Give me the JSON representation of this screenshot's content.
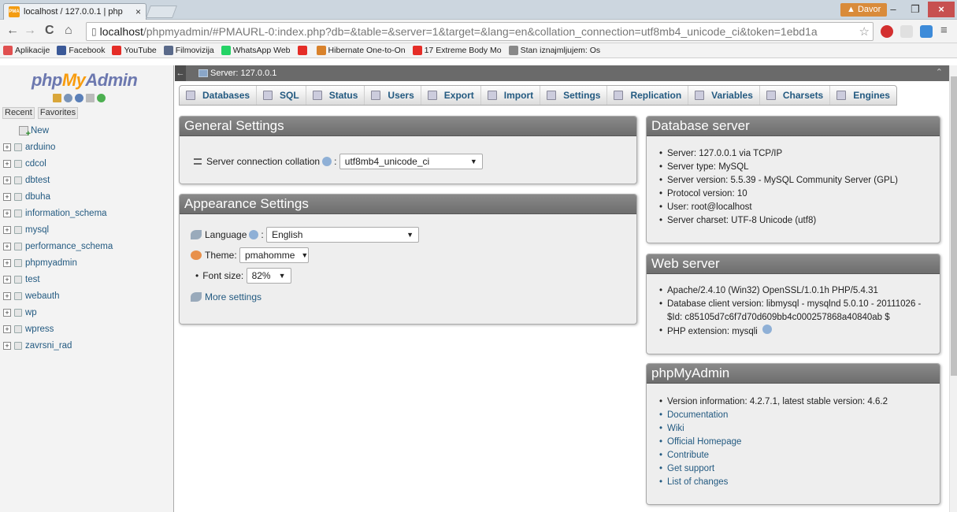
{
  "browser": {
    "tab_title": "localhost / 127.0.0.1 | php",
    "tab_close": "×",
    "user_badge": "Davor",
    "min": "–",
    "max": "❐",
    "close": "×",
    "url_host": "localhost",
    "url_rest": "/phpmyadmin/#PMAURL-0:index.php?db=&table=&server=1&target=&lang=en&collation_connection=utf8mb4_unicode_ci&token=1ebd1a",
    "back": "←",
    "forward": "→",
    "reload": "C",
    "home": "⌂",
    "star": "☆",
    "bookmarks": [
      {
        "label": "Aplikacije",
        "color": "#e05050"
      },
      {
        "label": "Facebook",
        "color": "#3b5998"
      },
      {
        "label": "YouTube",
        "color": "#e52d27"
      },
      {
        "label": "Filmovizija",
        "color": "#5a6a8a"
      },
      {
        "label": "WhatsApp Web",
        "color": "#25d366"
      },
      {
        "label": "",
        "color": "#e52d27"
      },
      {
        "label": "Hibernate One-to-On",
        "color": "#d9822b"
      },
      {
        "label": "17 Extreme Body Mo",
        "color": "#e52d27"
      },
      {
        "label": "Stan iznajmljujem: Os",
        "color": "#888888"
      }
    ]
  },
  "sidebar": {
    "logo_php": "php",
    "logo_my": "My",
    "logo_admin": "Admin",
    "recent": "Recent",
    "favorites": "Favorites",
    "new": "New",
    "databases": [
      "arduino",
      "cdcol",
      "dbtest",
      "dbuha",
      "information_schema",
      "mysql",
      "performance_schema",
      "phpmyadmin",
      "test",
      "webauth",
      "wp",
      "wpress",
      "zavrsni_rad"
    ]
  },
  "serverbar": {
    "arrow": "←",
    "server": "Server: 127.0.0.1"
  },
  "menu": [
    "Databases",
    "SQL",
    "Status",
    "Users",
    "Export",
    "Import",
    "Settings",
    "Replication",
    "Variables",
    "Charsets",
    "Engines"
  ],
  "general": {
    "title": "General Settings",
    "collation_label": "Server connection collation",
    "collation_value": "utf8mb4_unicode_ci"
  },
  "appearance": {
    "title": "Appearance Settings",
    "language_label": "Language",
    "language_value": "English",
    "theme_label": "Theme:",
    "theme_value": "pmahomme",
    "fontsize_label": "Font size:",
    "fontsize_value": "82%",
    "more_settings": "More settings"
  },
  "dbserver": {
    "title": "Database server",
    "items": [
      "Server: 127.0.0.1 via TCP/IP",
      "Server type: MySQL",
      "Server version: 5.5.39 - MySQL Community Server (GPL)",
      "Protocol version: 10",
      "User: root@localhost",
      "Server charset: UTF-8 Unicode (utf8)"
    ]
  },
  "webserver": {
    "title": "Web server",
    "items": [
      "Apache/2.4.10 (Win32) OpenSSL/1.0.1h PHP/5.4.31",
      "Database client version: libmysql - mysqlnd 5.0.10 - 20111026 - $Id: c85105d7c6f7d70d609bb4c000257868a40840ab $",
      "PHP extension: mysqli"
    ]
  },
  "pma": {
    "title": "phpMyAdmin",
    "version": "Version information: 4.2.7.1, latest stable version: 4.6.2",
    "links": [
      "Documentation",
      "Wiki",
      "Official Homepage",
      "Contribute",
      "Get support",
      "List of changes"
    ]
  }
}
